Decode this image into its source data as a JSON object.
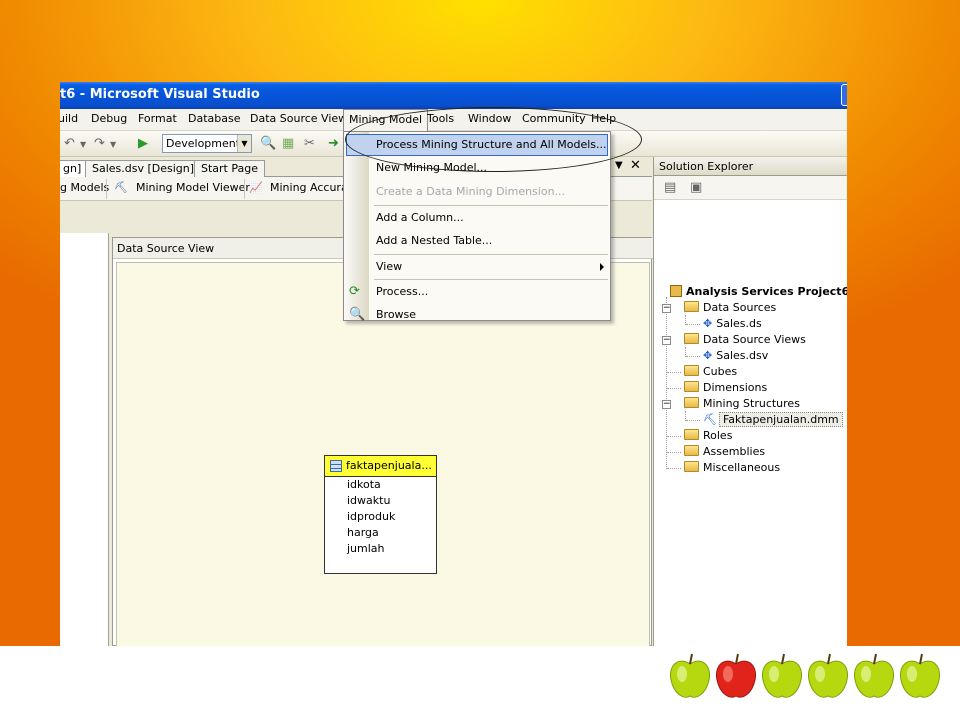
{
  "window": {
    "title": "t6 - Microsoft Visual Studio"
  },
  "menubar": {
    "items": [
      "uild",
      "Debug",
      "Format",
      "Database",
      "Data Source View",
      "Mining Model",
      "Tools",
      "Window",
      "Community",
      "Help"
    ]
  },
  "toolbar": {
    "config_value": "Development"
  },
  "doc_tabs": [
    "gn]",
    "Sales.dsv [Design]",
    "Start Page"
  ],
  "sub_tabs": [
    "g Models",
    "Mining Model Viewer",
    "Mining Accuracy"
  ],
  "panel": {
    "title": "Data Source View"
  },
  "table": {
    "name": "faktapenjuala...",
    "columns": [
      "idkota",
      "idwaktu",
      "idproduk",
      "harga",
      "jumlah"
    ]
  },
  "mining_menu": {
    "items": [
      {
        "label": "Process Mining Structure and All Models...",
        "state": "highlighted"
      },
      {
        "label": "New Mining Model...",
        "state": "enabled"
      },
      {
        "label": "Create a Data Mining Dimension...",
        "state": "disabled"
      },
      {
        "label": "Add a Column...",
        "state": "enabled"
      },
      {
        "label": "Add a Nested Table...",
        "state": "enabled"
      },
      {
        "label": "View",
        "state": "submenu"
      },
      {
        "label": "Process...",
        "state": "enabled"
      },
      {
        "label": "Browse",
        "state": "enabled"
      }
    ]
  },
  "solution_explorer": {
    "title": "Solution Explorer",
    "project": "Analysis Services Project6",
    "nodes": {
      "data_sources": "Data Sources",
      "sales_ds": "Sales.ds",
      "data_source_views": "Data Source Views",
      "sales_dsv": "Sales.dsv",
      "cubes": "Cubes",
      "dimensions": "Dimensions",
      "mining_structures": "Mining Structures",
      "dmm": "Faktapenjualan.dmm",
      "roles": "Roles",
      "assemblies": "Assemblies",
      "misc": "Miscellaneous"
    }
  },
  "colors": {
    "title_bar": "#0554d8",
    "menu_highlight": "#c1d2ee",
    "table_header": "#ffff33",
    "canvas": "#fbf8e4"
  }
}
